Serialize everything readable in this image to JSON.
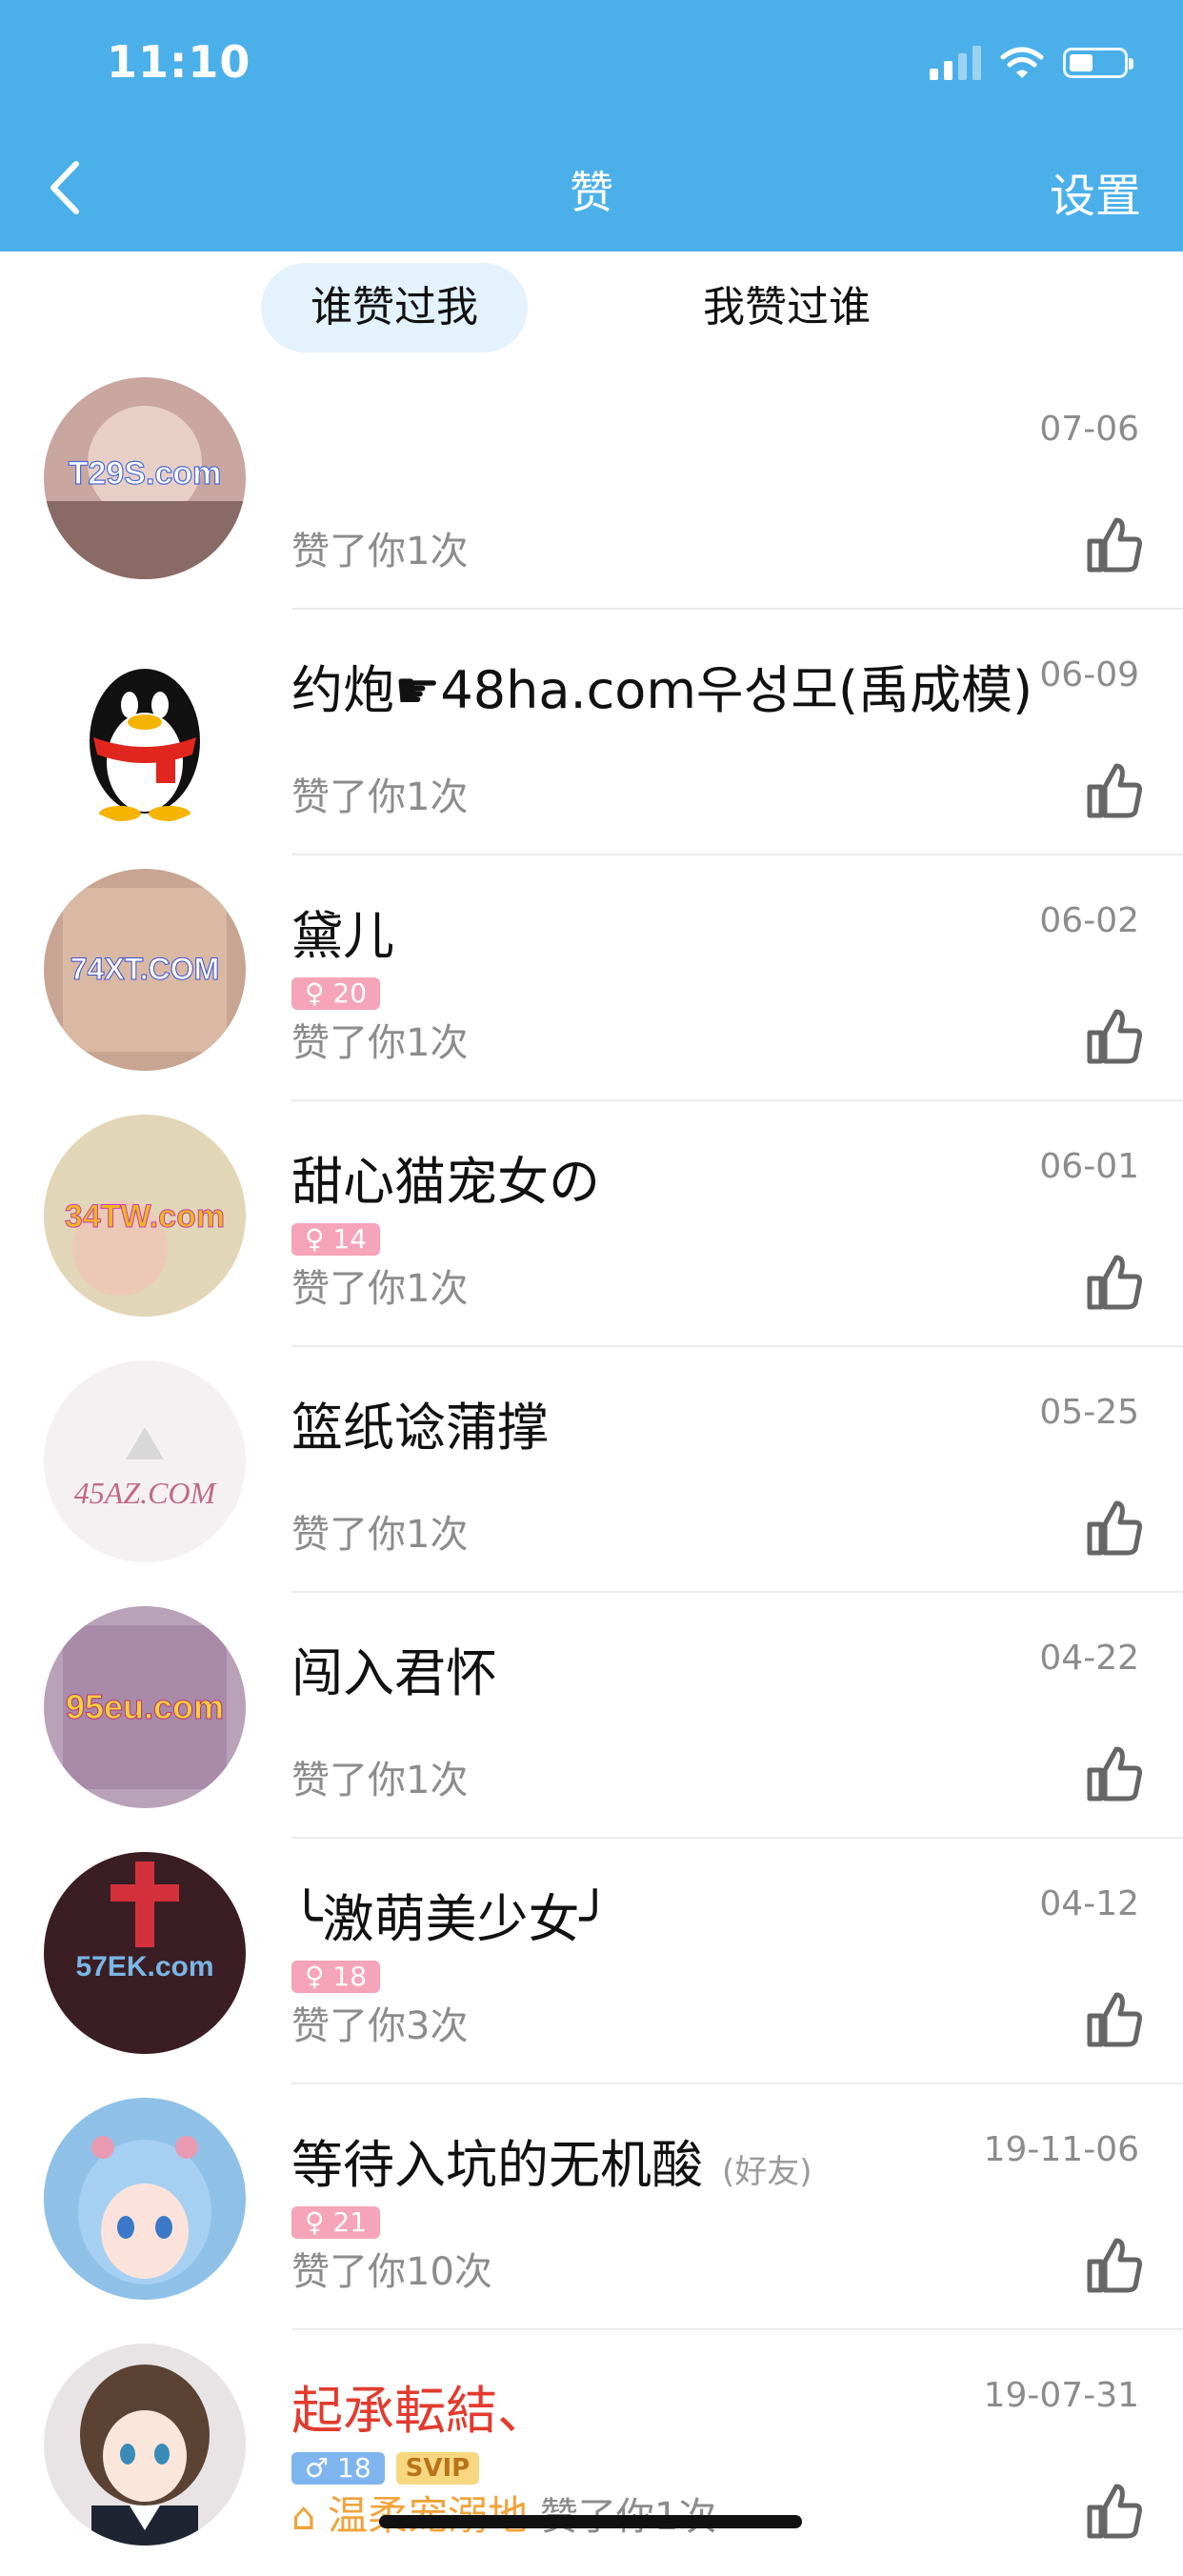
{
  "status_bar": {
    "time": "11:10"
  },
  "nav": {
    "title": "赞",
    "settings_label": "设置"
  },
  "tabs": [
    {
      "label": "谁赞过我",
      "active": true
    },
    {
      "label": "我赞过谁",
      "active": false
    }
  ],
  "items": [
    {
      "name": "",
      "date": "07-06",
      "liked": "赞了你1次",
      "avatar_color": "#c9a6a0",
      "avatar_text": "T29S.com"
    },
    {
      "name": "约炮☛48ha.com우성모(禹成模)",
      "date": "06-09",
      "liked": "赞了你1次",
      "avatar_color": "#ffffff",
      "avatar_text": ""
    },
    {
      "name": "黛儿",
      "badge": "♀ 20",
      "date": "06-02",
      "liked": "赞了你1次",
      "avatar_color": "#c8a592",
      "avatar_text": "74XT.COM"
    },
    {
      "name": "甜心猫宠女の",
      "badge": "♀ 14",
      "date": "06-01",
      "liked": "赞了你1次",
      "avatar_color": "#e2d6b8",
      "avatar_text": "34TW.com"
    },
    {
      "name": "篮纸谂蒲撑",
      "date": "05-25",
      "liked": "赞了你1次",
      "avatar_color": "#f5f1f2",
      "avatar_text": "45AZ.COM"
    },
    {
      "name": "闯入君怀",
      "date": "04-22",
      "liked": "赞了你1次",
      "avatar_color": "#b9a2b8",
      "avatar_text": "95eu.com"
    },
    {
      "name": "╰激萌美少女╯",
      "badge": "♀ 18",
      "date": "04-12",
      "liked": "赞了你3次",
      "avatar_color": "#3a1e24",
      "avatar_text": "57EK.com"
    },
    {
      "name": "等待入坑的无机酸",
      "friend": "(好友)",
      "badge": "♀ 21",
      "date": "19-11-06",
      "liked": "赞了你10次",
      "avatar_color": "#8fc1e8",
      "avatar_text": ""
    },
    {
      "name": "起承転結、",
      "name_color": "red",
      "badge_m": "♂ 18",
      "svip": "SVIP",
      "date": "19-07-31",
      "liked_prefix": "温柔宠溺地",
      "liked": "赞了你1次",
      "avatar_color": "#e8e4e6",
      "avatar_text": ""
    }
  ]
}
